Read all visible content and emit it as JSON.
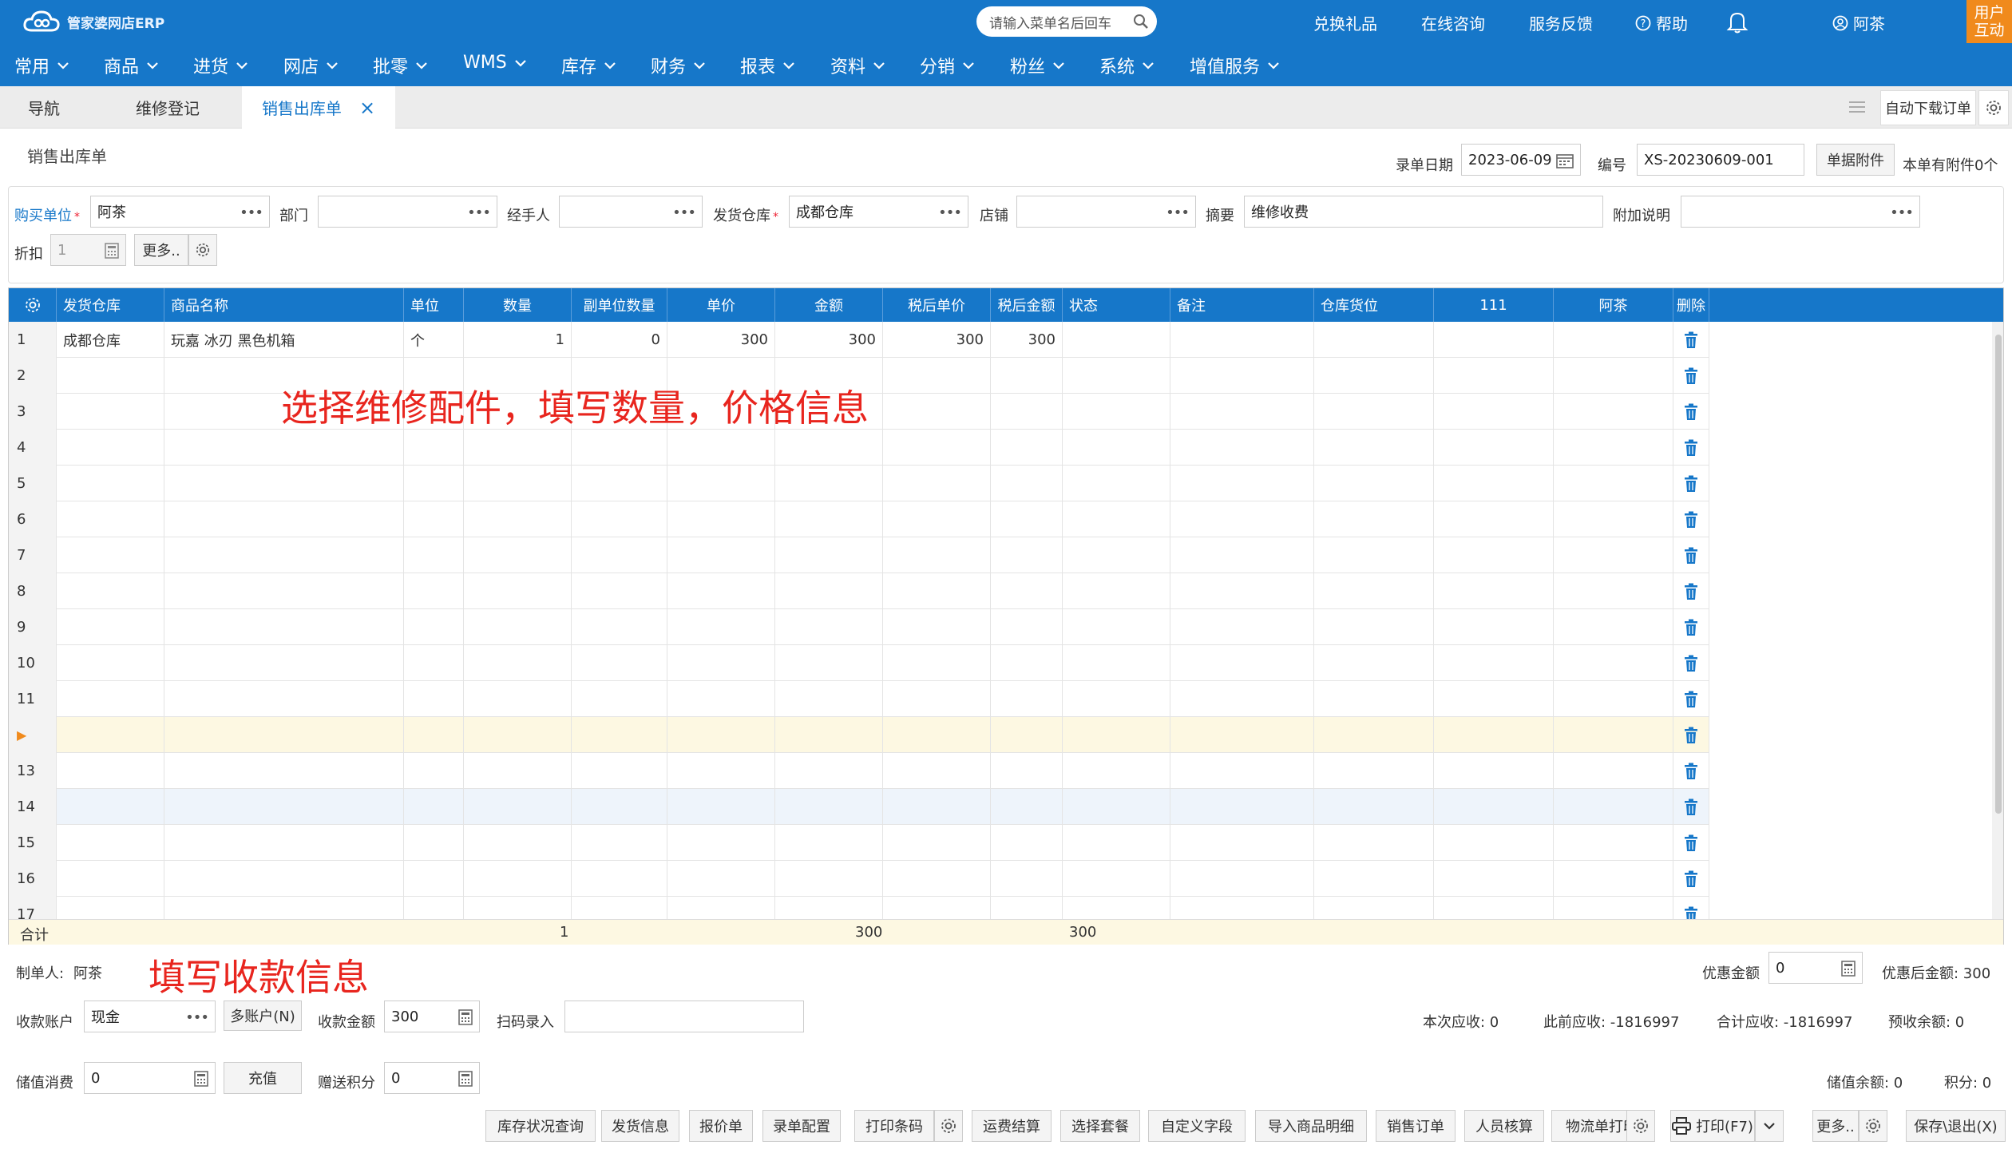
{
  "app": {
    "logo_text": "管家婆网店ERP"
  },
  "header": {
    "search_placeholder": "请输入菜单名后回车",
    "links": [
      "兑换礼品",
      "在线咨询",
      "服务反馈"
    ],
    "help": "帮助",
    "user": "阿茶",
    "user_interact": [
      "用户",
      "互动"
    ]
  },
  "menu": [
    "常用",
    "商品",
    "进货",
    "网店",
    "批零",
    "WMS",
    "库存",
    "财务",
    "报表",
    "资料",
    "分销",
    "粉丝",
    "系统",
    "增值服务"
  ],
  "tabs": [
    {
      "label": "导航",
      "active": false
    },
    {
      "label": "维修登记",
      "active": false
    },
    {
      "label": "销售出库单",
      "active": true
    }
  ],
  "toolbar_right": {
    "auto_download": "自动下载订单"
  },
  "doc": {
    "title": "销售出库单",
    "date_label": "录单日期",
    "date": "2023-06-09",
    "no_label": "编号",
    "no": "XS-20230609-001",
    "attach_btn": "单据附件",
    "attach_info": "本单有附件0个"
  },
  "form": {
    "buyer_label": "购买单位",
    "buyer": "阿茶",
    "dept_label": "部门",
    "dept": "",
    "handler_label": "经手人",
    "handler": "",
    "warehouse_label": "发货仓库",
    "warehouse": "成都仓库",
    "shop_label": "店铺",
    "shop": "",
    "summary_label": "摘要",
    "summary": "维修收费",
    "extra_label": "附加说明",
    "extra": "",
    "discount_label": "折扣",
    "discount": "1",
    "more_btn": "更多.."
  },
  "grid": {
    "columns": [
      "发货仓库",
      "商品名称",
      "单位",
      "数量",
      "副单位数量",
      "单价",
      "金额",
      "税后单价",
      "税后金额",
      "状态",
      "备注",
      "仓库货位",
      "111",
      "阿茶",
      "删除"
    ],
    "rows": [
      {
        "no": "1",
        "warehouse": "成都仓库",
        "name": "玩嘉 冰刃 黑色机箱",
        "unit": "个",
        "qty": "1",
        "sub_qty": "0",
        "price": "300",
        "amount": "300",
        "tax_price": "300",
        "tax_amount": "300"
      },
      {
        "no": "2"
      },
      {
        "no": "3"
      },
      {
        "no": "4"
      },
      {
        "no": "5"
      },
      {
        "no": "6"
      },
      {
        "no": "7"
      },
      {
        "no": "8"
      },
      {
        "no": "9"
      },
      {
        "no": "10"
      },
      {
        "no": "11"
      },
      {
        "no": "▶"
      },
      {
        "no": "13"
      },
      {
        "no": "14"
      },
      {
        "no": "15"
      },
      {
        "no": "16"
      },
      {
        "no": "17"
      }
    ],
    "footer": {
      "label": "合计",
      "qty": "1",
      "amount": "300",
      "tax_amount": "300"
    }
  },
  "annotations": {
    "grid_note": "选择维修配件，填写数量，价格信息",
    "pay_note": "填写收款信息"
  },
  "bottom": {
    "maker_label": "制单人:",
    "maker": "阿茶",
    "discount_amt_label": "优惠金额",
    "discount_amt": "0",
    "after_discount": "优惠后金额:  300",
    "pay_account_label": "收款账户",
    "pay_account": "现金",
    "multi_account": "多账户(N)",
    "pay_amount_label": "收款金额",
    "pay_amount": "300",
    "scan_label": "扫码录入",
    "receivable_now": "本次应收:  0",
    "receivable_prev": "此前应收:  -1816997",
    "receivable_total": "合计应收:  -1816997",
    "prepaid": "预收余额:  0",
    "stored_label": "储值消费",
    "stored": "0",
    "recharge": "充值",
    "points_label": "赠送积分",
    "points": "0",
    "stored_balance": "储值余额:  0",
    "points_balance": "积分:  0"
  },
  "actions": [
    "库存状况查询",
    "发货信息",
    "报价单",
    "录单配置",
    "打印条码",
    "运费结算",
    "选择套餐",
    "自定义字段",
    "导入商品明细",
    "销售订单",
    "人员核算",
    "物流单打印",
    "打印(F7)",
    "更多..",
    "保存\\退出(X)"
  ],
  "colors": {
    "primary": "#1677c9",
    "orange": "#f08a1c",
    "annotation": "#e8251e",
    "highlight_row": "#fdf8e2",
    "selected_row": "#eef4fb"
  }
}
